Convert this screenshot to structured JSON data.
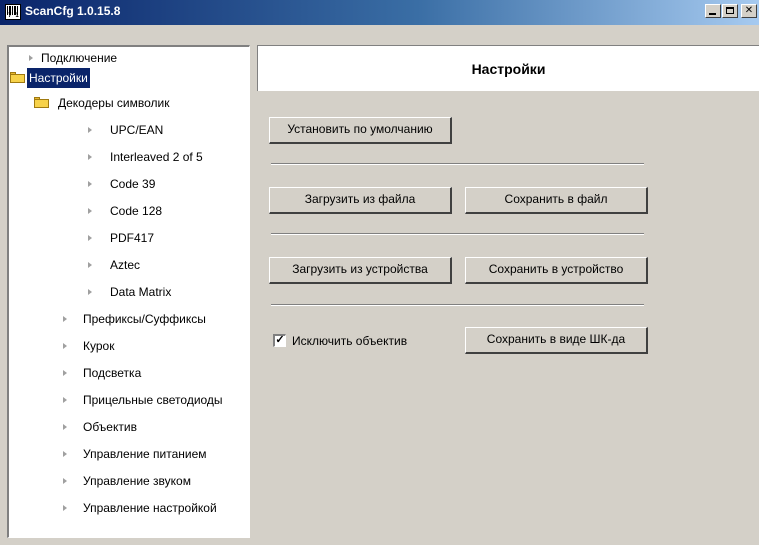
{
  "window": {
    "title": "ScanCfg 1.0.15.8",
    "icon_name": "barcode-icon",
    "icon_caption": "7 1"
  },
  "tree": {
    "items": [
      {
        "label": "Подключение",
        "icon": "arrow-icon",
        "level": 0
      },
      {
        "label": "Настройки",
        "icon": "folder-icon",
        "level": 0,
        "selected": true
      },
      {
        "label": "Декодеры символик",
        "icon": "folder-icon",
        "level": 1
      },
      {
        "label": "UPC/EAN",
        "icon": "arrow-icon",
        "level": 2
      },
      {
        "label": "Interleaved 2 of 5",
        "icon": "arrow-icon",
        "level": 2
      },
      {
        "label": "Code 39",
        "icon": "arrow-icon",
        "level": 2
      },
      {
        "label": "Code 128",
        "icon": "arrow-icon",
        "level": 2
      },
      {
        "label": "PDF417",
        "icon": "arrow-icon",
        "level": 2
      },
      {
        "label": "Aztec",
        "icon": "arrow-icon",
        "level": 2
      },
      {
        "label": "Data Matrix",
        "icon": "arrow-icon",
        "level": 2
      },
      {
        "label": "Префиксы/Суффиксы",
        "icon": "arrow-icon",
        "level": 1
      },
      {
        "label": "Курок",
        "icon": "arrow-icon",
        "level": 1
      },
      {
        "label": "Подсветка",
        "icon": "arrow-icon",
        "level": 1
      },
      {
        "label": "Прицельные светодиоды",
        "icon": "arrow-icon",
        "level": 1
      },
      {
        "label": "Объектив",
        "icon": "arrow-icon",
        "level": 1
      },
      {
        "label": "Управление питанием",
        "icon": "arrow-icon",
        "level": 1
      },
      {
        "label": "Управление звуком",
        "icon": "arrow-icon",
        "level": 1
      },
      {
        "label": "Управление настройкой",
        "icon": "arrow-icon",
        "level": 1
      }
    ]
  },
  "panel": {
    "header_title": "Настройки",
    "reset_button": "Установить по умолчанию",
    "load_file_button": "Загрузить из файла",
    "save_file_button": "Сохранить в файл",
    "load_device_button": "Загрузить из устройства",
    "save_device_button": "Сохранить в устройство",
    "exclude_lens_label": "Исключить объектив",
    "exclude_lens_checked": true,
    "save_barcode_button": "Сохранить в виде ШК-да"
  },
  "colors": {
    "titlebar_start": "#0a246a",
    "titlebar_end": "#a6caf0",
    "selection": "#0a246a",
    "window_bg": "#d4d0c8",
    "folder": "#f7d24a"
  }
}
